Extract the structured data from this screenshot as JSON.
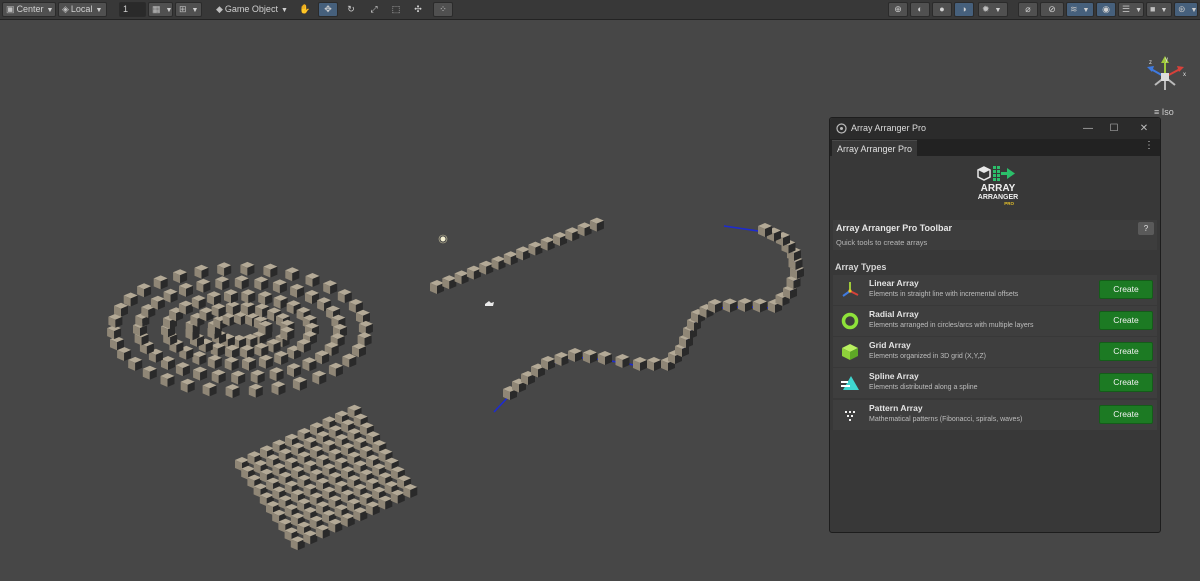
{
  "toolbar": {
    "pivot_label": "Center",
    "space_label": "Local",
    "grid_snap_value": "1",
    "object_mode_label": "Game Object"
  },
  "scene": {
    "view_mode_label": "Iso",
    "gizmo_axes": {
      "x": "x",
      "y": "y",
      "z": "z"
    }
  },
  "window": {
    "title": "Array Arranger Pro",
    "tab_label": "Array Arranger Pro",
    "logo": {
      "line1": "ARRAY",
      "line2": "ARRANGER",
      "line3": "PRO"
    },
    "header_title": "Array Arranger Pro Toolbar",
    "header_subtitle": "Quick tools to create arrays",
    "help_label": "?",
    "section_title": "Array Types",
    "array_types": [
      {
        "name": "Linear Array",
        "description": "Elements in straight line with incremental offsets",
        "button": "Create"
      },
      {
        "name": "Radial Array",
        "description": "Elements arranged in circles/arcs with multiple layers",
        "button": "Create"
      },
      {
        "name": "Grid Array",
        "description": "Elements organized in 3D grid (X,Y,Z)",
        "button": "Create"
      },
      {
        "name": "Spline Array",
        "description": "Elements distributed along a spline",
        "button": "Create"
      },
      {
        "name": "Pattern Array",
        "description": "Mathematical patterns (Fibonacci, spirals, waves)",
        "button": "Create"
      }
    ]
  },
  "colors": {
    "scene_bg": "#474747",
    "toolbar_bg": "#383838",
    "window_bg": "#383838",
    "create_button": "#1c7a23",
    "logo_green": "#2bbf6a",
    "spline_line": "#1d2bd0"
  }
}
